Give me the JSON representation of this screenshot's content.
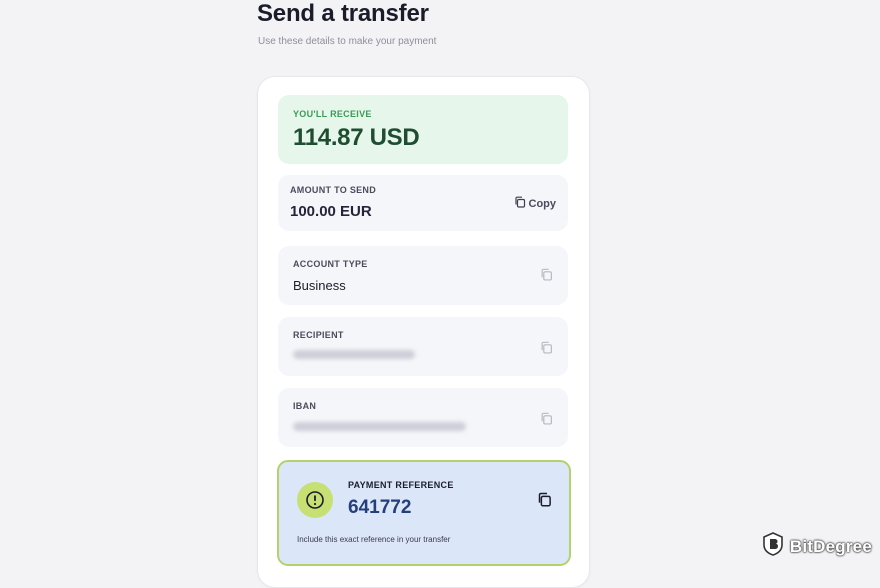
{
  "page": {
    "title": "Send a transfer",
    "subtitle": "Use these details to make your payment"
  },
  "receive": {
    "label": "YOU'LL RECEIVE",
    "amount": "114.87 USD"
  },
  "amount_to_send": {
    "label": "AMOUNT TO SEND",
    "value": "100.00 EUR",
    "copy_label": "Copy"
  },
  "account_type": {
    "label": "ACCOUNT TYPE",
    "value": "Business"
  },
  "recipient": {
    "label": "RECIPIENT"
  },
  "iban": {
    "label": "IBAN"
  },
  "payment_reference": {
    "label": "PAYMENT REFERENCE",
    "value": "641772",
    "note": "Include this exact reference in your transfer"
  },
  "watermark": {
    "text": "BitDegree"
  },
  "colors": {
    "receive_bg": "#e6f6ea",
    "receive_label": "#3a9b57",
    "reference_bg": "#dbe6f8",
    "reference_border": "#b5d26a",
    "alert_icon_bg": "#c7e074"
  }
}
